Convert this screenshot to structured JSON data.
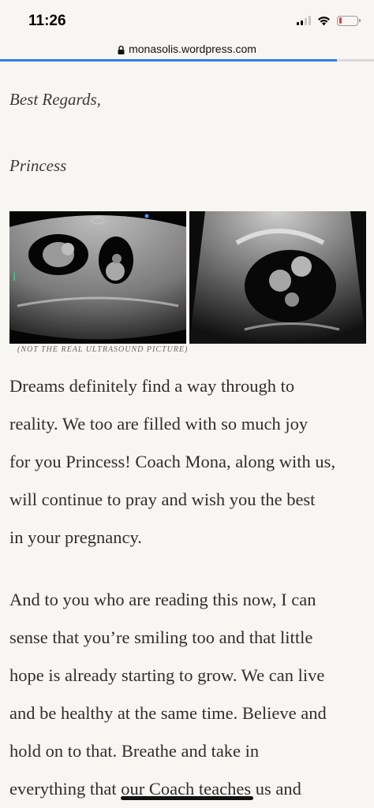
{
  "status_bar": {
    "time": "11:26",
    "battery_level": 0.15,
    "battery_color": "#e43a36"
  },
  "browser": {
    "url": "monasolis.wordpress.com",
    "load_progress": 0.9,
    "progress_color": "#2f7ef6"
  },
  "post": {
    "closing": "Best Regards,",
    "signature": "Princess",
    "image_caption": "(NOT THE REAL ULTRASOUND PICTURE)",
    "paragraph1_lines": [
      "Dreams definitely find a way through to",
      "reality. We too are filled with so much joy",
      "for you Princess! Coach Mona, along with us,",
      "will continue to pray and wish you the best",
      "in your pregnancy."
    ],
    "paragraph2_lines": [
      "And to you who are reading this now, I can",
      "sense that you’re smiling too and that little",
      "hope is already starting to grow. We can live",
      "and be healthy at the same time. Believe and",
      "hold on to that. Breathe and take in",
      "everything that our Coach teaches us and"
    ]
  }
}
